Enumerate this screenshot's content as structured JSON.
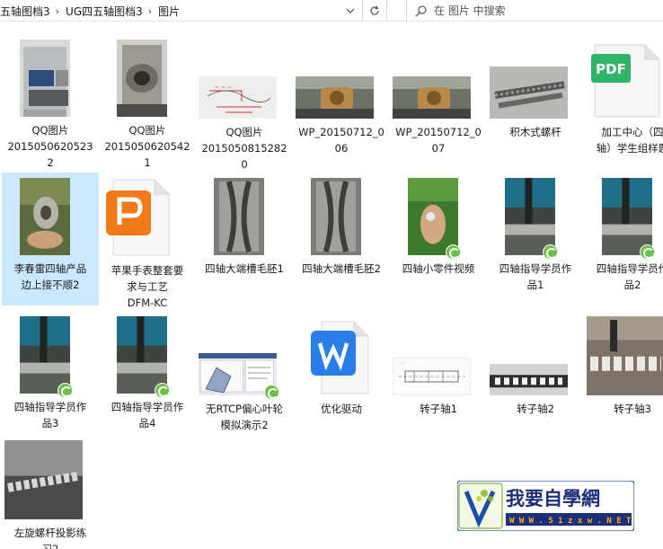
{
  "breadcrumb": [
    {
      "label": "五轴图档3"
    },
    {
      "label": "UG四五轴图档3"
    },
    {
      "label": "图片"
    }
  ],
  "search": {
    "placeholder": "在 图片 中搜索"
  },
  "files": [
    {
      "name": "QQ图片20150506205232",
      "lines": [
        "QQ图片",
        "2015050620523",
        "2"
      ],
      "kind": "photo",
      "thumb": "machine-panel"
    },
    {
      "name": "QQ图片20150506205421",
      "lines": [
        "QQ图片",
        "2015050620542",
        "1"
      ],
      "kind": "photo",
      "thumb": "machine-chuck"
    },
    {
      "name": "QQ图片20150508152820",
      "lines": [
        "QQ图片",
        "2015050815282",
        "0"
      ],
      "kind": "photo",
      "thumb": "sketch"
    },
    {
      "name": "WP_20150712_006",
      "lines": [
        "WP_20150712_0",
        "06"
      ],
      "kind": "photo",
      "thumb": "workpiece"
    },
    {
      "name": "WP_20150712_007",
      "lines": [
        "WP_20150712_0",
        "07"
      ],
      "kind": "photo",
      "thumb": "workpiece"
    },
    {
      "name": "积木式螺杆",
      "lines": [
        "积木式螺杆"
      ],
      "kind": "photo",
      "thumb": "screw"
    },
    {
      "name": "加工中心（四轴）学生组样题",
      "lines": [
        "加工中心（四",
        "轴）学生组样题"
      ],
      "kind": "pdf",
      "thumb": "pdf",
      "badge_text": "PDF"
    },
    {
      "name": "李春雷四轴产品边上接不顺2",
      "lines": [
        "李春雷四轴产品",
        "边上接不顺2"
      ],
      "kind": "photo",
      "thumb": "part-hand",
      "selected": true
    },
    {
      "name": "苹果手表整套要求与工艺DFM-KC",
      "lines": [
        "苹果手表整套要",
        "求与工艺",
        "DFM-KC"
      ],
      "kind": "wps-p",
      "thumb": "p-doc"
    },
    {
      "name": "四轴大端槽毛胚1",
      "lines": [
        "四轴大端槽毛胚1"
      ],
      "kind": "photo",
      "thumb": "groove"
    },
    {
      "name": "四轴大端槽毛胚2",
      "lines": [
        "四轴大端槽毛胚2"
      ],
      "kind": "photo",
      "thumb": "groove"
    },
    {
      "name": "四轴小零件视频",
      "lines": [
        "四轴小零件视频"
      ],
      "kind": "video",
      "thumb": "hand-green"
    },
    {
      "name": "四轴指导学员作品1",
      "lines": [
        "四轴指导学员作",
        "品1"
      ],
      "kind": "video",
      "thumb": "mill"
    },
    {
      "name": "四轴指导学员作品2",
      "lines": [
        "四轴指导学员作",
        "品2"
      ],
      "kind": "video",
      "thumb": "mill"
    },
    {
      "name": "四轴指导学员作品3",
      "lines": [
        "四轴指导学员作",
        "品3"
      ],
      "kind": "video",
      "thumb": "mill"
    },
    {
      "name": "四轴指导学员作品4",
      "lines": [
        "四轴指导学员作",
        "品4"
      ],
      "kind": "video",
      "thumb": "mill"
    },
    {
      "name": "无RTCP偏心叶轮模拟演示2",
      "lines": [
        "无RTCP偏心叶轮",
        "模拟演示2"
      ],
      "kind": "video",
      "thumb": "cad"
    },
    {
      "name": "优化驱动",
      "lines": [
        "优化驱动"
      ],
      "kind": "wps-w",
      "thumb": "w-doc"
    },
    {
      "name": "转子轴1",
      "lines": [
        "转子轴1"
      ],
      "kind": "photo",
      "thumb": "drawing"
    },
    {
      "name": "转子轴2",
      "lines": [
        "转子轴2"
      ],
      "kind": "photo",
      "thumb": "rotor"
    },
    {
      "name": "转子轴3",
      "lines": [
        "转子轴3"
      ],
      "kind": "photo",
      "thumb": "rotor-big"
    },
    {
      "name": "左旋螺杆投影练习2",
      "lines": [
        "左旋螺杆投影练",
        "习2"
      ],
      "kind": "photo",
      "thumb": "screw-dark"
    }
  ],
  "watermark": {
    "title": "我要自學網",
    "url": "W W W . 5 1 z x w . N E T"
  },
  "colors": {
    "selected_bg": "#cce8ff",
    "video_badge": "#6cc04a",
    "pdf_green": "#2fb56a",
    "wps_orange": "#f07a1a",
    "wps_blue": "#2b7de9"
  }
}
